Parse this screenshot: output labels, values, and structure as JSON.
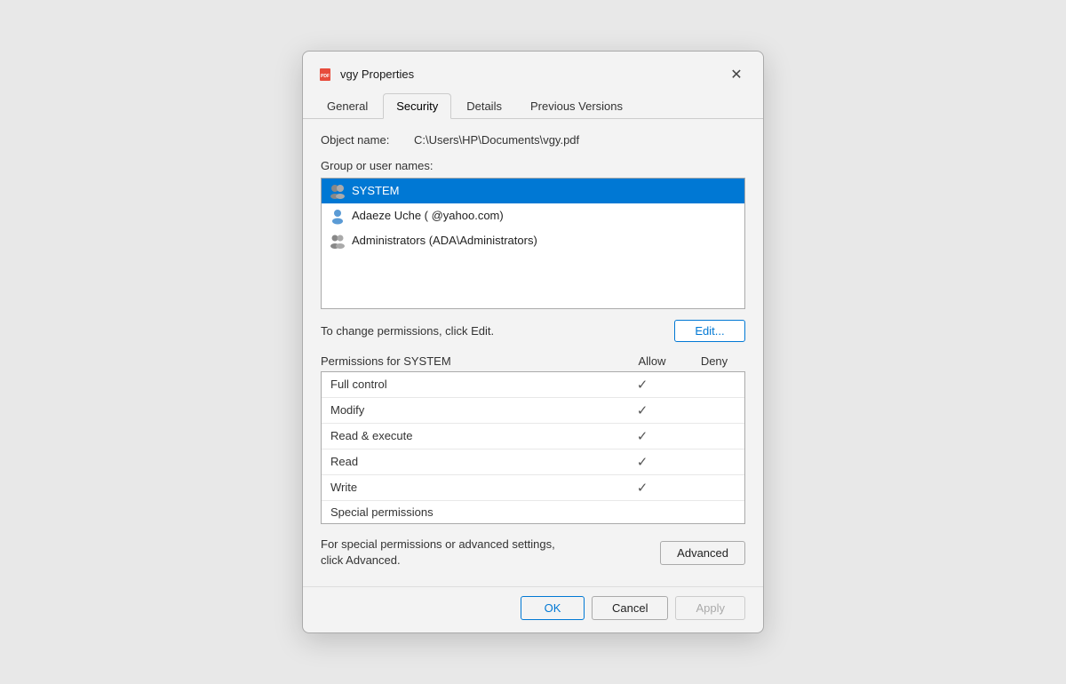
{
  "title_bar": {
    "icon": "pdf-icon",
    "title": "vgy Properties",
    "close_label": "✕"
  },
  "tabs": [
    {
      "label": "General",
      "active": false
    },
    {
      "label": "Security",
      "active": true
    },
    {
      "label": "Details",
      "active": false
    },
    {
      "label": "Previous Versions",
      "active": false
    }
  ],
  "object_name_label": "Object name:",
  "object_name_value": "C:\\Users\\HP\\Documents\\vgy.pdf",
  "group_label": "Group or user names:",
  "users": [
    {
      "name": "SYSTEM",
      "type": "system",
      "selected": true
    },
    {
      "name": "Adaeze Uche (                 @yahoo.com)",
      "type": "user",
      "selected": false
    },
    {
      "name": "Administrators (ADA\\Administrators)",
      "type": "group",
      "selected": false
    }
  ],
  "change_permissions_text": "To change permissions, click Edit.",
  "edit_button_label": "Edit...",
  "permissions_title": "Permissions for SYSTEM",
  "permissions_allow_header": "Allow",
  "permissions_deny_header": "Deny",
  "permissions": [
    {
      "name": "Full control",
      "allow": true,
      "deny": false
    },
    {
      "name": "Modify",
      "allow": true,
      "deny": false
    },
    {
      "name": "Read & execute",
      "allow": true,
      "deny": false
    },
    {
      "name": "Read",
      "allow": true,
      "deny": false
    },
    {
      "name": "Write",
      "allow": true,
      "deny": false
    },
    {
      "name": "Special permissions",
      "allow": false,
      "deny": false
    }
  ],
  "advanced_text": "For special permissions or advanced settings, click Advanced.",
  "advanced_button_label": "Advanced",
  "footer": {
    "ok_label": "OK",
    "cancel_label": "Cancel",
    "apply_label": "Apply"
  }
}
